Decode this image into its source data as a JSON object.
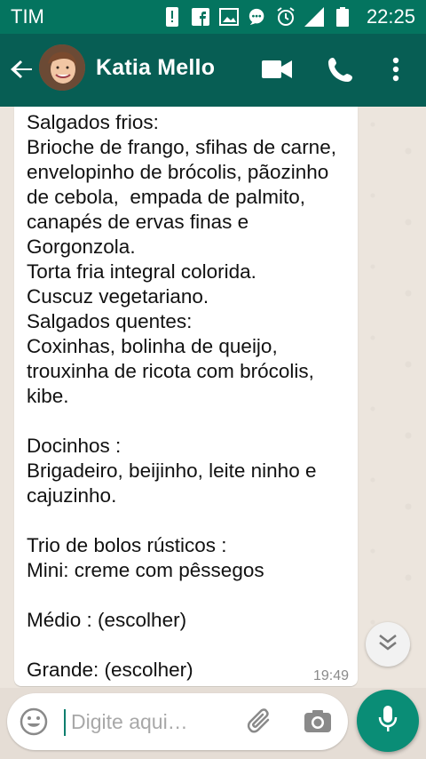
{
  "status_bar": {
    "carrier": "TIM",
    "time": "22:25"
  },
  "header": {
    "contact_name": "Katia Mello",
    "icons": [
      "back-arrow-icon",
      "video-call-icon",
      "phone-icon",
      "more-vert-icon"
    ]
  },
  "message": {
    "text": "Salgados frios:\nBrioche de frango, sfihas de carne, envelopinho de brócolis, pãozinho de cebola,  empada de palmito,  canapés de ervas finas e Gorgonzola.\nTorta fria integral colorida.\nCuscuz vegetariano.\nSalgados quentes:\nCoxinhas, bolinha de queijo, trouxinha de ricota com brócolis, kibe.\n\nDocinhos :\nBrigadeiro, beijinho, leite ninho e cajuzinho.\n\nTrio de bolos rústicos :\nMini: creme com pêssegos\n\nMédio : (escolher)\n\nGrande: (escolher)",
    "time": "19:49"
  },
  "composer": {
    "placeholder": "Digite aqui…",
    "value": ""
  },
  "colors": {
    "status_bar": "#04745f",
    "app_bar": "#075e54",
    "send_button": "#0a8d76"
  }
}
